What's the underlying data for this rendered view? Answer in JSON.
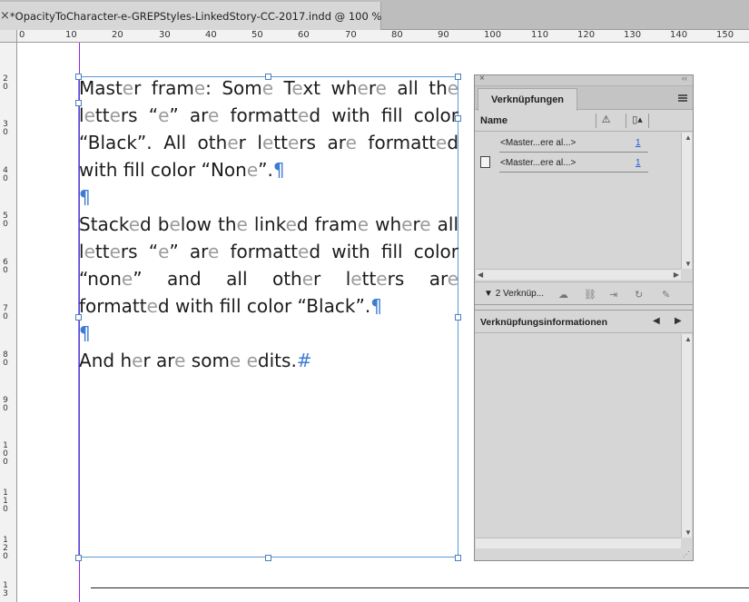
{
  "tab": {
    "close_glyph": "×",
    "title": "*OpacityToCharacter-e-GREPStyles-LinkedStory-CC-2017.indd @ 100 %"
  },
  "ruler": {
    "h_labels": [
      "0",
      "10",
      "20",
      "30",
      "40",
      "50",
      "60",
      "70",
      "80",
      "90",
      "100",
      "110",
      "120",
      "130",
      "140",
      "150"
    ],
    "v_labels": [
      "2\n0",
      "3\n0",
      "4\n0",
      "5\n0",
      "6\n0",
      "7\n0",
      "8\n0",
      "9\n0",
      "1\n0\n0",
      "1\n1\n0",
      "1\n2\n0",
      "1\n3"
    ]
  },
  "story": {
    "paragraphs": [
      "Master frame: Some Text where all the letters “e” are formatted with fill color “Black”. All other letters are formatted with fill color “None”.",
      "",
      "Stacked below the linked frame where all letters “e” are formatted with fill color “none” and all other letters are formatted with fill color “Black”.",
      "",
      "And her are some edits."
    ],
    "pilcrow": "¶",
    "end_mark": "#"
  },
  "links_panel": {
    "close_glyph": "×",
    "collapse_glyph": "‹‹",
    "tab_label": "Verknüpfungen",
    "col_name": "Name",
    "col_status_icon": "warning-icon",
    "col_page_icon": "page-icon",
    "rows": [
      {
        "name": "<Master...ere al...>",
        "page": "1",
        "icon": ""
      },
      {
        "name": "<Master...ere al...>",
        "page": "1",
        "icon": "document-icon"
      }
    ],
    "count_label": "2 Verknüp...",
    "info_label": "Verknüpfungsinformationen",
    "colors": {
      "panel_bg": "#d6d6d6",
      "link_blue": "#1a5fd6",
      "frame_blue": "#5b9bd5",
      "bleed_purple": "#8a2be2"
    }
  }
}
